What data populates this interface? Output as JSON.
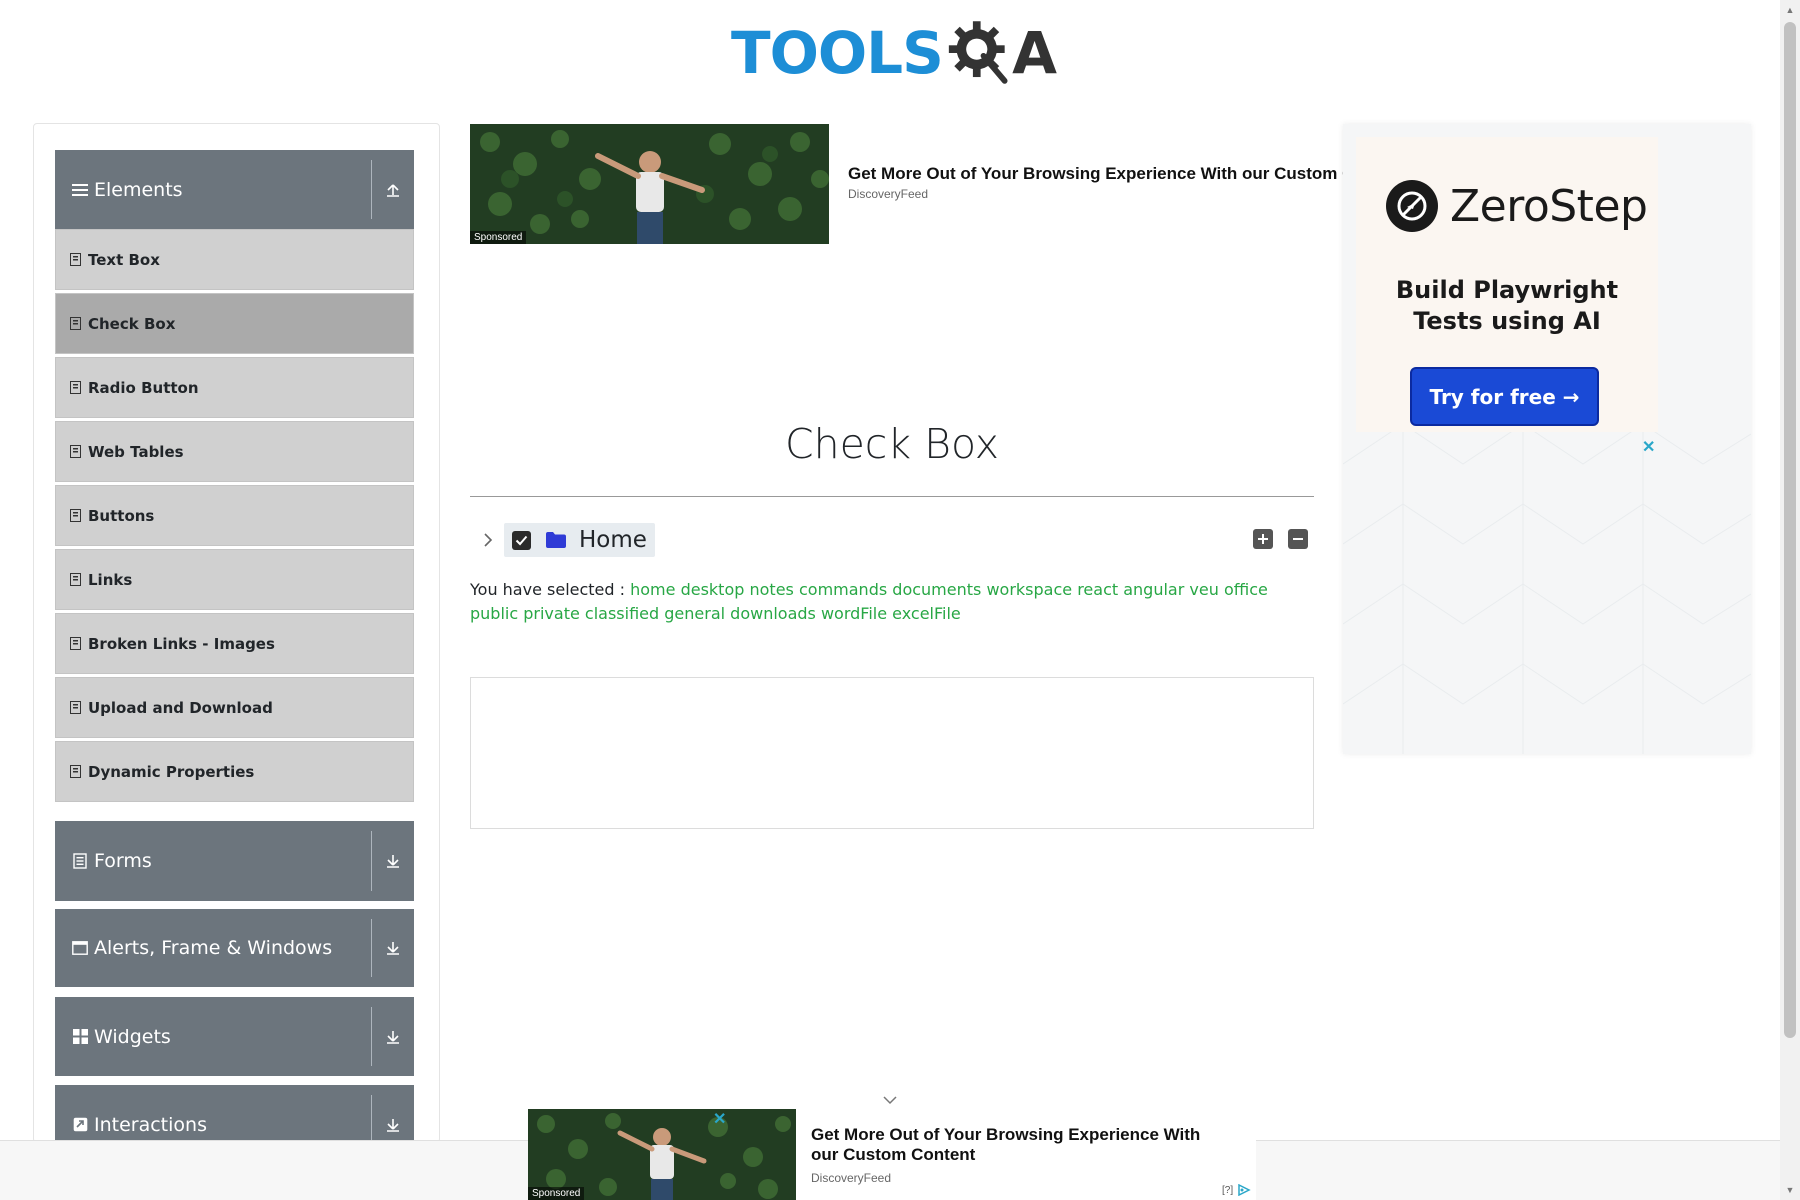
{
  "header": {
    "logo_tools": "TOOLS",
    "logo_a": "A"
  },
  "sidebar": {
    "groups": [
      {
        "label": "Elements",
        "icon": "hamburger-icon",
        "state": "expanded"
      },
      {
        "label": "Forms",
        "icon": "form-icon",
        "state": "collapsed"
      },
      {
        "label": "Alerts, Frame & Windows",
        "icon": "window-icon",
        "state": "collapsed"
      },
      {
        "label": "Widgets",
        "icon": "grid-icon",
        "state": "collapsed"
      },
      {
        "label": "Interactions",
        "icon": "interactions-icon",
        "state": "collapsed"
      }
    ],
    "elements_items": [
      {
        "label": "Text Box",
        "active": false
      },
      {
        "label": "Check Box",
        "active": true
      },
      {
        "label": "Radio Button",
        "active": false
      },
      {
        "label": "Web Tables",
        "active": false
      },
      {
        "label": "Buttons",
        "active": false
      },
      {
        "label": "Links",
        "active": false
      },
      {
        "label": "Broken Links - Images",
        "active": false
      },
      {
        "label": "Upload and Download",
        "active": false
      },
      {
        "label": "Dynamic Properties",
        "active": false
      }
    ]
  },
  "top_ad": {
    "title": "Get More Out of Your Browsing Experience With our Custom Content",
    "source": "DiscoveryFeed",
    "sponsored": "Sponsored"
  },
  "main": {
    "title": "Check Box",
    "tree": {
      "root_label": "Home",
      "root_checked": true,
      "expanded": false
    },
    "result_prefix": "You have selected :",
    "selected": [
      "home",
      "desktop",
      "notes",
      "commands",
      "documents",
      "workspace",
      "react",
      "angular",
      "veu",
      "office",
      "public",
      "private",
      "classified",
      "general",
      "downloads",
      "wordFile",
      "excelFile"
    ]
  },
  "right_ad": {
    "brand": "ZeroStep",
    "headline_line1": "Build Playwright",
    "headline_line2": "Tests using AI",
    "cta": "Try for free →",
    "close": "✕"
  },
  "bottom_ad": {
    "title": "Get More Out of Your Browsing Experience With our Custom Content",
    "source": "DiscoveryFeed",
    "sponsored": "Sponsored",
    "close": "✕",
    "adchoices": "[?]"
  },
  "colors": {
    "sidebar_header": "#6c757d",
    "menu_item": "#d0d0d0",
    "menu_item_active": "#aaaaaa",
    "selected_text": "#28a745",
    "logo_blue": "#1d8ed6",
    "cta_blue": "#1a4ad6"
  }
}
